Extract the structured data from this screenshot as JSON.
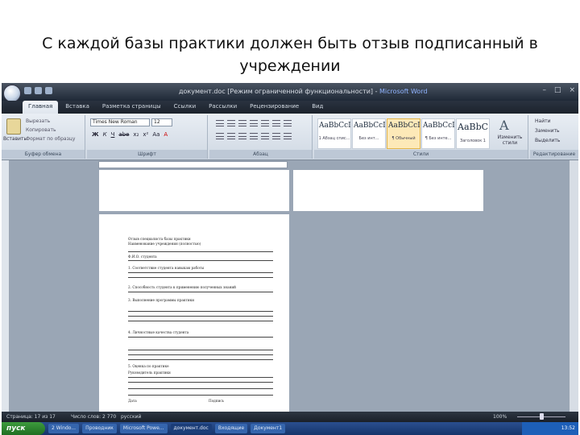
{
  "slide": {
    "title_line1": "С каждой базы практики должен быть отзыв подписанный в",
    "title_line2": "учреждении"
  },
  "window": {
    "title": "документ.doc [Режим ограниченной функциональности]",
    "app_name": "Microsoft Word",
    "controls": {
      "minimize": "–",
      "maximize": "□",
      "close": "×"
    }
  },
  "tabs": [
    "Главная",
    "Вставка",
    "Разметка страницы",
    "Ссылки",
    "Рассылки",
    "Рецензирование",
    "Вид"
  ],
  "ribbon": {
    "clipboard": {
      "paste": "Вставить",
      "cut": "Вырезать",
      "copy": "Копировать",
      "format_painter": "Формат по образцу",
      "label": "Буфер обмена"
    },
    "font": {
      "name": "Times New Roman",
      "size": "12",
      "buttons": [
        "Ж",
        "К",
        "Ч",
        "abe",
        "x₂",
        "x²",
        "Aa",
        "A"
      ],
      "label": "Шрифт"
    },
    "paragraph": {
      "label": "Абзац"
    },
    "styles": {
      "items": [
        {
          "sample": "AaBbCcDc",
          "name": "1 Абзац спис..."
        },
        {
          "sample": "AaBbCcD",
          "name": "Без инт..."
        },
        {
          "sample": "AaBbCcDc",
          "name": "¶ Обычный"
        },
        {
          "sample": "AaBbCcDc",
          "name": "¶ Без инте..."
        },
        {
          "sample": "AaBbC",
          "name": "Заголовок 1"
        }
      ],
      "change": "Изменить стили",
      "label": "Стили"
    },
    "editing": {
      "find": "Найти",
      "replace": "Заменить",
      "select": "Выделить",
      "label": "Редактирование"
    }
  },
  "document": {
    "lines": [
      "Отзыв специалиста базы практики",
      "Наименование учреждения (полностью)",
      "Ф.И.О. студента",
      "1. Соответствие студента навыкам работы",
      "2. Способность студента к применению полученных знаний",
      "3. Выполнение программы практики",
      "4. Личностные качества студента",
      "5. Оценка по практике",
      "Руководитель практики",
      "Дата",
      "Подпись"
    ]
  },
  "statusbar": {
    "page": "Страница: 17 из 17",
    "words": "Число слов: 2 770",
    "language": "русский",
    "zoom": "100%"
  },
  "taskbar": {
    "start": "пуск",
    "tasks": [
      "2 Windo...",
      "Проводник",
      "Microsoft Powe...",
      "документ.doc",
      "Входящие",
      "Документ1"
    ],
    "clock": "13:52"
  }
}
